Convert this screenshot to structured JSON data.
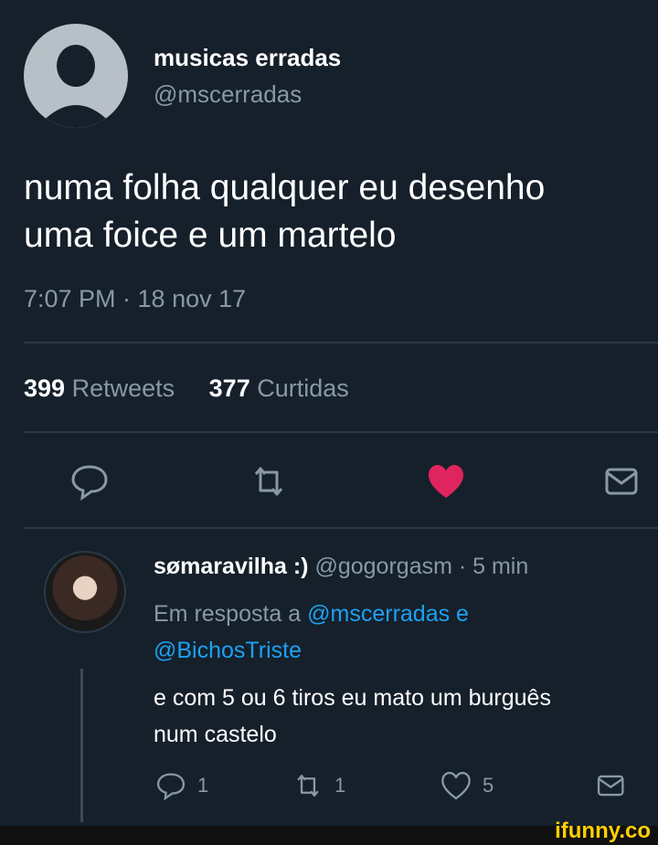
{
  "author": {
    "name": "musicas erradas",
    "handle": "@mscerradas"
  },
  "tweet": {
    "lines": [
      "numa folha qualquer eu desenho",
      "uma foice e um martelo"
    ],
    "meta": "7:07 PM · 18 nov 17"
  },
  "stats": {
    "retweets_count": "399",
    "retweets_label": "Retweets",
    "likes_count": "377",
    "likes_label": "Curtidas"
  },
  "actions": [
    "reply-icon",
    "retweet-icon",
    "heart-icon",
    "message-icon"
  ],
  "reply": {
    "name": "sømaravilha :)",
    "handle_time": "@gogorgasm · 5 min",
    "in_reply_prefix": "Em resposta a",
    "mention1": "@mscerradas e",
    "mention2": "@BichosTriste",
    "lines": [
      "e com 5 ou 6 tiros eu mato um burguês",
      "num castelo"
    ],
    "reply_count": "1",
    "retweet_count": "1",
    "like_count": "5"
  },
  "watermark": "ifunny.co",
  "colors": {
    "background": "#15202b",
    "muted": "#8899a6",
    "link": "#1da1f2",
    "like": "#e0245e"
  }
}
